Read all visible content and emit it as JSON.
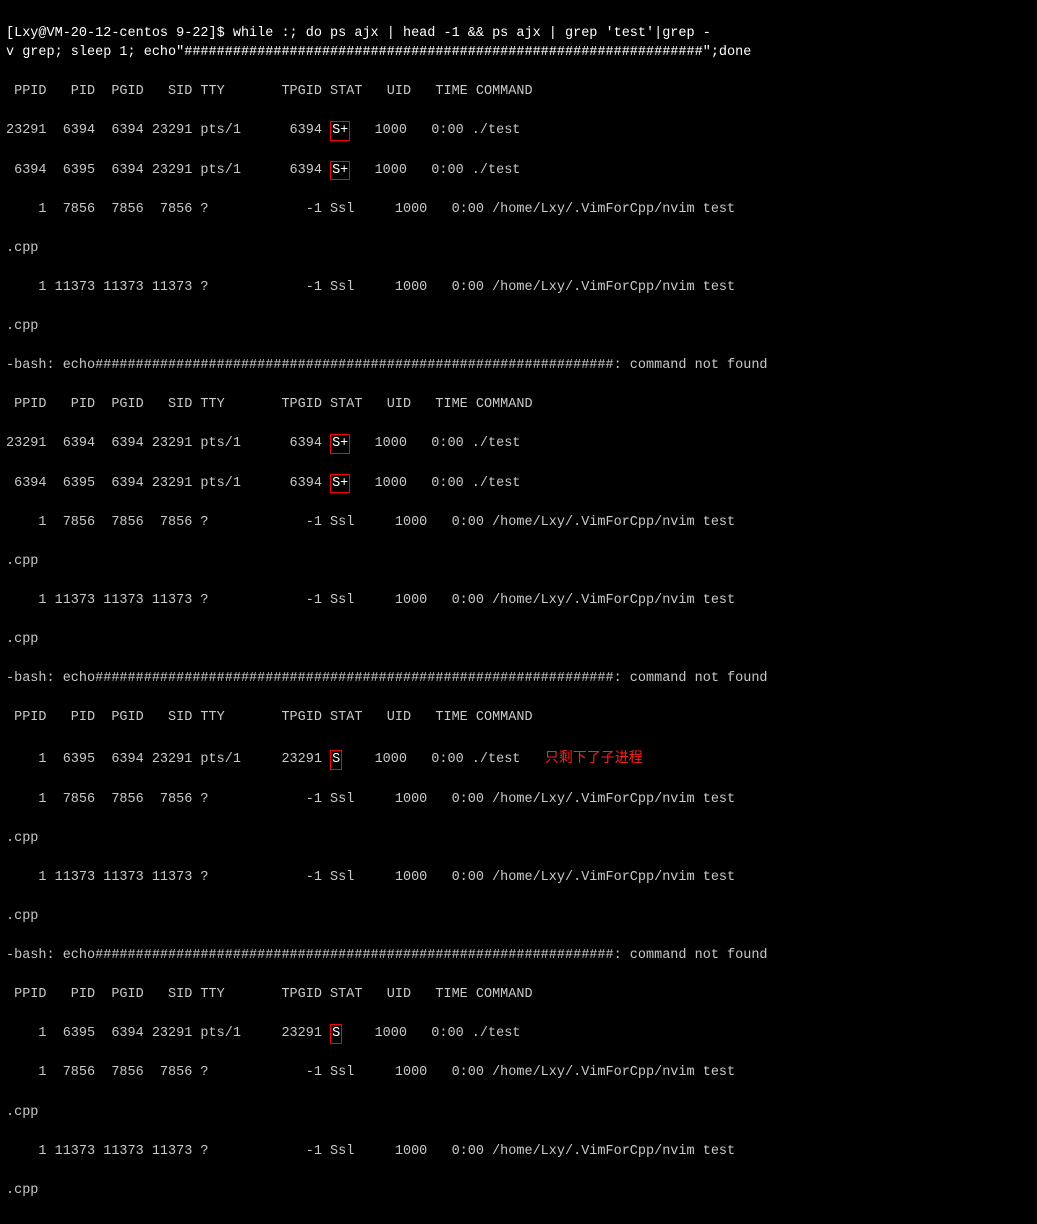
{
  "terminal": {
    "prompt_line": "[Lxy@VM-20-12-centos 9-22]$ while :; do ps ajx | head -1 && ps ajx | grep 'test'|grep -v grep; sleep 1; echo\"################################################################\";done",
    "blocks": [
      {
        "header": " PPID   PID  PGID   SID TTY       TPGID STAT   UID   TIME COMMAND",
        "rows": [
          {
            "text": "23291  6394  6394 23291 pts/1      6394 ",
            "stat": "S+",
            "rest": "  1000   0:00 ./test",
            "ann": ""
          },
          {
            "text": " 6394  6395  6394 23291 pts/1      6394 ",
            "stat": "S+",
            "rest": "  1000   0:00 ./test",
            "ann": ""
          },
          {
            "text": "    1  7856  7856  7856 ?            -1 Ssl     1000   0:00 /home/Lxy/.VimForCpp/nvim test",
            "stat": "",
            "rest": "",
            "ann": ""
          },
          {
            "text": ".cpp",
            "stat": "",
            "rest": "",
            "ann": ""
          }
        ]
      },
      {
        "extra_row": "    1 11373 11373 11373 ?            -1 Ssl     1000   0:00 /home/Lxy/.VimForCpp/nvim test",
        "extra_row2": ".cpp"
      },
      {
        "bash_line": "-bash: echo################################################################: command not found",
        "header": " PPID   PID  PGID   SID TTY       TPGID STAT   UID   TIME COMMAND",
        "rows": [
          {
            "text": "23291  6394  6394 23291 pts/1      6394 ",
            "stat": "S+",
            "rest": "  1000   0:00 ./test",
            "ann": ""
          },
          {
            "text": " 6394  6395  6394 23291 pts/1      6394 ",
            "stat": "S+",
            "rest": "  1000   0:00 ./test",
            "ann": ""
          },
          {
            "text": "    1  7856  7856  7856 ?            -1 Ssl     1000   0:00 /home/Lxy/.VimForCpp/nvim test",
            "stat": "",
            "rest": "",
            "ann": ""
          },
          {
            "text": ".cpp",
            "stat": "",
            "rest": "",
            "ann": ""
          }
        ]
      },
      {
        "extra_row": "    1 11373 11373 11373 ?            -1 Ssl     1000   0:00 /home/Lxy/.VimForCpp/nvim test",
        "extra_row2": ".cpp"
      },
      {
        "bash_line": "-bash: echo################################################################: command not found",
        "header": " PPID   PID  PGID   SID TTY       TPGID STAT   UID   TIME COMMAND",
        "rows": [
          {
            "text": "    1  6395  6394 23291 pts/1     23291 ",
            "stat": "S",
            "rest": "  1000   0:00 ./test",
            "ann": "只剩下了子进程"
          },
          {
            "text": "    1  7856  7856  7856 ?            -1 Ssl     1000   0:00 /home/Lxy/.VimForCpp/nvim test",
            "stat": "",
            "rest": "",
            "ann": ""
          },
          {
            "text": ".cpp",
            "stat": "",
            "rest": "",
            "ann": ""
          }
        ]
      },
      {
        "extra_row": "    1 11373 11373 11373 ?            -1 Ssl     1000   0:00 /home/Lxy/.VimForCpp/nvim test",
        "extra_row2": ".cpp"
      },
      {
        "bash_line": "-bash: echo################################################################: command not found",
        "header": " PPID   PID  PGID   SID TTY       TPGID STAT   UID   TIME COMMAND",
        "rows": [
          {
            "text": "    1  6395  6394 23291 pts/1     23291 ",
            "stat": "S",
            "rest": "  1000   0:00 ./test",
            "ann": ""
          },
          {
            "text": "    1  7856  7856  7856 ?            -1 Ssl     1000   0:00 /home/Lxy/.VimForCpp/nvim test",
            "stat": "",
            "rest": "",
            "ann": ""
          },
          {
            "text": ".cpp",
            "stat": "",
            "rest": "",
            "ann": ""
          }
        ]
      },
      {
        "extra_row": "    1 11373 11373 11373 ?            -1 Ssl     1000   0:00 /home/Lxy/.VimForCpp/nvim test",
        "extra_row2": ".cpp"
      }
    ]
  }
}
